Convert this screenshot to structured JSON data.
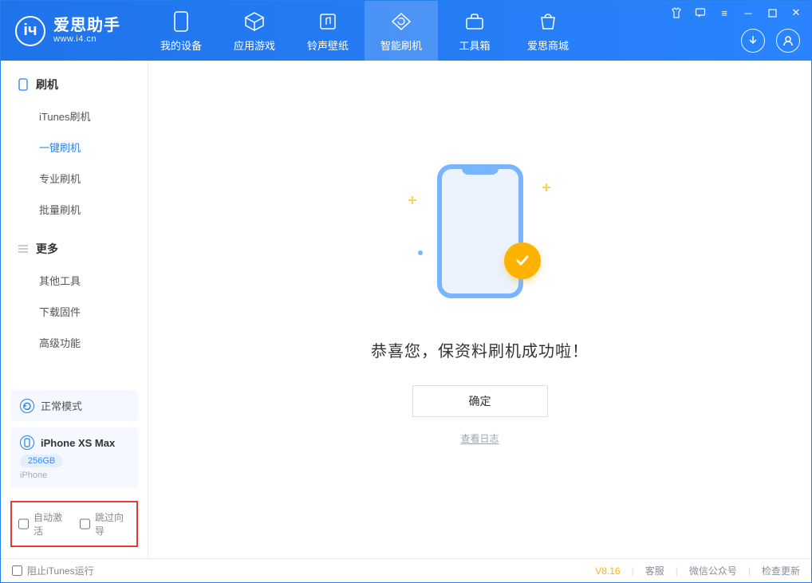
{
  "app": {
    "logo_cn": "爱思助手",
    "logo_sub": "www.i4.cn"
  },
  "nav": {
    "tabs": [
      {
        "label": "我的设备",
        "icon": "device"
      },
      {
        "label": "应用游戏",
        "icon": "cube"
      },
      {
        "label": "铃声壁纸",
        "icon": "music"
      },
      {
        "label": "智能刷机",
        "icon": "refresh",
        "active": true
      },
      {
        "label": "工具箱",
        "icon": "toolbox"
      },
      {
        "label": "爱思商城",
        "icon": "store"
      }
    ]
  },
  "sidebar": {
    "sections": [
      {
        "title": "刷机",
        "icon": "phone",
        "items": [
          "iTunes刷机",
          "一键刷机",
          "专业刷机",
          "批量刷机"
        ],
        "active_index": 1
      },
      {
        "title": "更多",
        "icon": "menu",
        "items": [
          "其他工具",
          "下载固件",
          "高级功能"
        ],
        "active_index": -1
      }
    ],
    "mode_label": "正常模式",
    "device": {
      "name": "iPhone XS Max",
      "capacity": "256GB",
      "type": "iPhone"
    },
    "options": {
      "auto_activate": "自动激活",
      "skip_guide": "跳过向导"
    }
  },
  "main": {
    "success_text": "恭喜您，保资料刷机成功啦！",
    "ok_button": "确定",
    "view_log": "查看日志"
  },
  "footer": {
    "block_itunes": "阻止iTunes运行",
    "version": "V8.16",
    "links": [
      "客服",
      "微信公众号",
      "检查更新"
    ]
  }
}
